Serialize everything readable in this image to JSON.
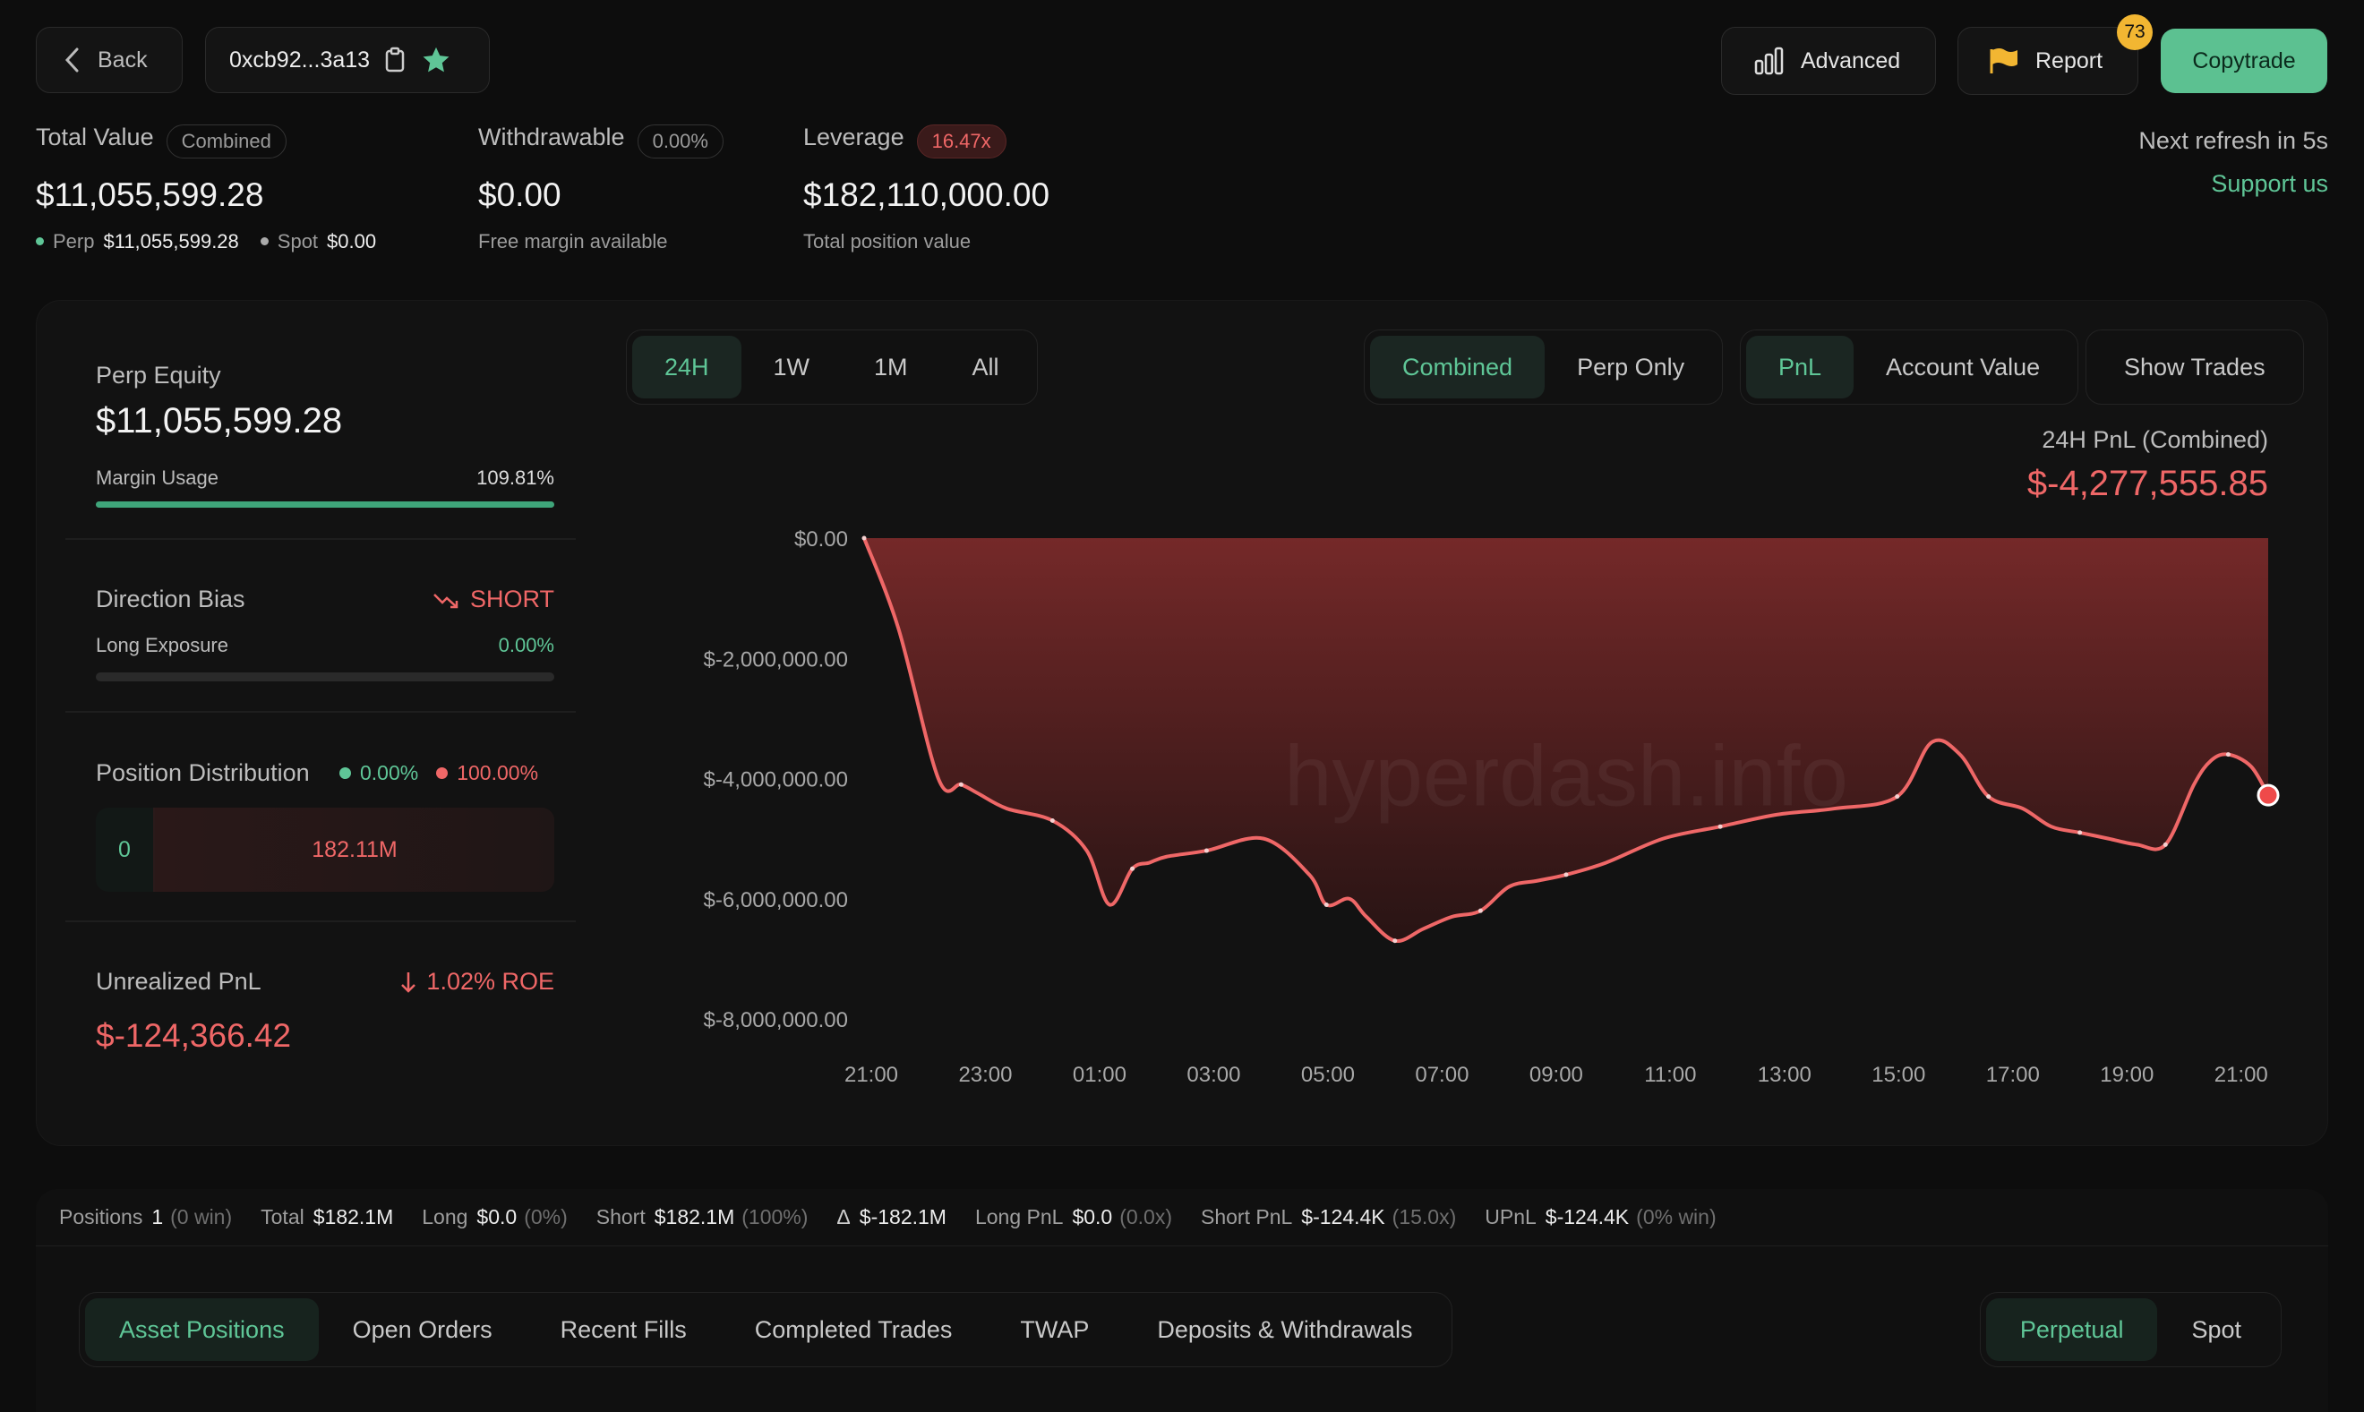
{
  "header": {
    "back_label": "Back",
    "address": "0xcb92...3a13",
    "advanced_label": "Advanced",
    "report_label": "Report",
    "report_badge": "73",
    "copytrade_label": "Copytrade",
    "refresh_text": "Next refresh in 5s",
    "support_label": "Support us"
  },
  "summary": {
    "total_value": {
      "label": "Total Value",
      "tag": "Combined",
      "value": "$11,055,599.28",
      "perp_label": "Perp",
      "perp_value": "$11,055,599.28",
      "spot_label": "Spot",
      "spot_value": "$0.00"
    },
    "withdrawable": {
      "label": "Withdrawable",
      "tag": "0.00%",
      "value": "$0.00",
      "sub": "Free margin available"
    },
    "leverage": {
      "label": "Leverage",
      "tag": "16.47x",
      "value": "$182,110,000.00",
      "sub": "Total position value"
    }
  },
  "panel": {
    "perp_equity_label": "Perp Equity",
    "perp_equity_value": "$11,055,599.28",
    "margin_usage_label": "Margin Usage",
    "margin_usage_value": "109.81%",
    "margin_usage_fraction": 1.0,
    "direction_bias_label": "Direction Bias",
    "direction_value": "SHORT",
    "long_exposure_label": "Long Exposure",
    "long_exposure_value": "0.00%",
    "position_distribution_label": "Position Distribution",
    "dist_long_pct": "0.00%",
    "dist_short_pct": "100.00%",
    "dist_long_value": "0",
    "dist_short_value": "182.11M",
    "upnl_label": "Unrealized PnL",
    "roe": "1.02% ROE",
    "upnl_value": "$-124,366.42"
  },
  "controls": {
    "range_tabs": [
      "24H",
      "1W",
      "1M",
      "All"
    ],
    "range_active": 0,
    "mode_tabs": [
      "Combined",
      "Perp Only"
    ],
    "mode_active": 0,
    "metric_tabs": [
      "PnL",
      "Account Value"
    ],
    "metric_active": 0,
    "show_trades_label": "Show Trades"
  },
  "chart_header": {
    "title": "24H PnL (Combined)",
    "value": "$-4,277,555.85"
  },
  "chart_data": {
    "type": "area",
    "watermark": "hyperdash.info",
    "yticks": [
      "$0.00",
      "$-2,000,000.00",
      "$-4,000,000.00",
      "$-6,000,000.00",
      "$-8,000,000.00"
    ],
    "ylim": [
      -8000000,
      0
    ],
    "xticks": [
      "21:00",
      "23:00",
      "01:00",
      "03:00",
      "05:00",
      "07:00",
      "09:00",
      "11:00",
      "13:00",
      "15:00",
      "17:00",
      "19:00",
      "21:00"
    ],
    "xlim": [
      0,
      24.6
    ],
    "x": [
      0,
      0.6,
      1.3,
      1.7,
      2.0,
      2.5,
      3.3,
      3.9,
      4.3,
      4.7,
      5.0,
      5.3,
      6.0,
      7.0,
      7.8,
      8.1,
      8.5,
      8.8,
      9.3,
      9.8,
      10.3,
      10.8,
      11.3,
      11.8,
      12.3,
      13.0,
      14.0,
      15.0,
      16.0,
      17.0,
      18.1,
      18.7,
      19.2,
      19.7,
      20.3,
      20.8,
      21.3,
      21.8,
      22.3,
      22.8,
      23.3,
      23.6,
      23.9,
      24.3,
      24.6
    ],
    "y": [
      0,
      -1500000,
      -4000000,
      -4100000,
      -4250000,
      -4500000,
      -4700000,
      -5200000,
      -6100000,
      -5500000,
      -5400000,
      -5300000,
      -5200000,
      -5000000,
      -5600000,
      -6100000,
      -6000000,
      -6300000,
      -6700000,
      -6500000,
      -6300000,
      -6200000,
      -5800000,
      -5700000,
      -5600000,
      -5400000,
      -5000000,
      -4800000,
      -4600000,
      -4500000,
      -4300000,
      -3400000,
      -3600000,
      -4300000,
      -4500000,
      -4800000,
      -4900000,
      -5000000,
      -5100000,
      -5100000,
      -4100000,
      -3700000,
      -3600000,
      -3800000,
      -4277555
    ]
  },
  "stats": {
    "positions_label": "Positions",
    "positions_value": "1",
    "positions_meta": "(0 win)",
    "total_label": "Total",
    "total_value": "$182.1M",
    "long_label": "Long",
    "long_value": "$0.0",
    "long_meta": "(0%)",
    "short_label": "Short",
    "short_value": "$182.1M",
    "short_meta": "(100%)",
    "delta_label": "Δ",
    "delta_value": "$-182.1M",
    "long_pnl_label": "Long PnL",
    "long_pnl_value": "$0.0",
    "long_pnl_meta": "(0.0x)",
    "short_pnl_label": "Short PnL",
    "short_pnl_value": "$-124.4K",
    "short_pnl_meta": "(15.0x)",
    "upnl_label": "UPnL",
    "upnl_value": "$-124.4K",
    "upnl_meta": "(0% win)"
  },
  "bottom_tabs": [
    "Asset Positions",
    "Open Orders",
    "Recent Fills",
    "Completed Trades",
    "TWAP",
    "Deposits & Withdrawals"
  ],
  "bottom_tabs_active": 0,
  "market_tabs": [
    "Perpetual",
    "Spot"
  ],
  "market_tabs_active": 0,
  "colors": {
    "accent": "#5fc697",
    "loss": "#ef6767",
    "background": "#0d0d0d",
    "card": "#121212"
  }
}
